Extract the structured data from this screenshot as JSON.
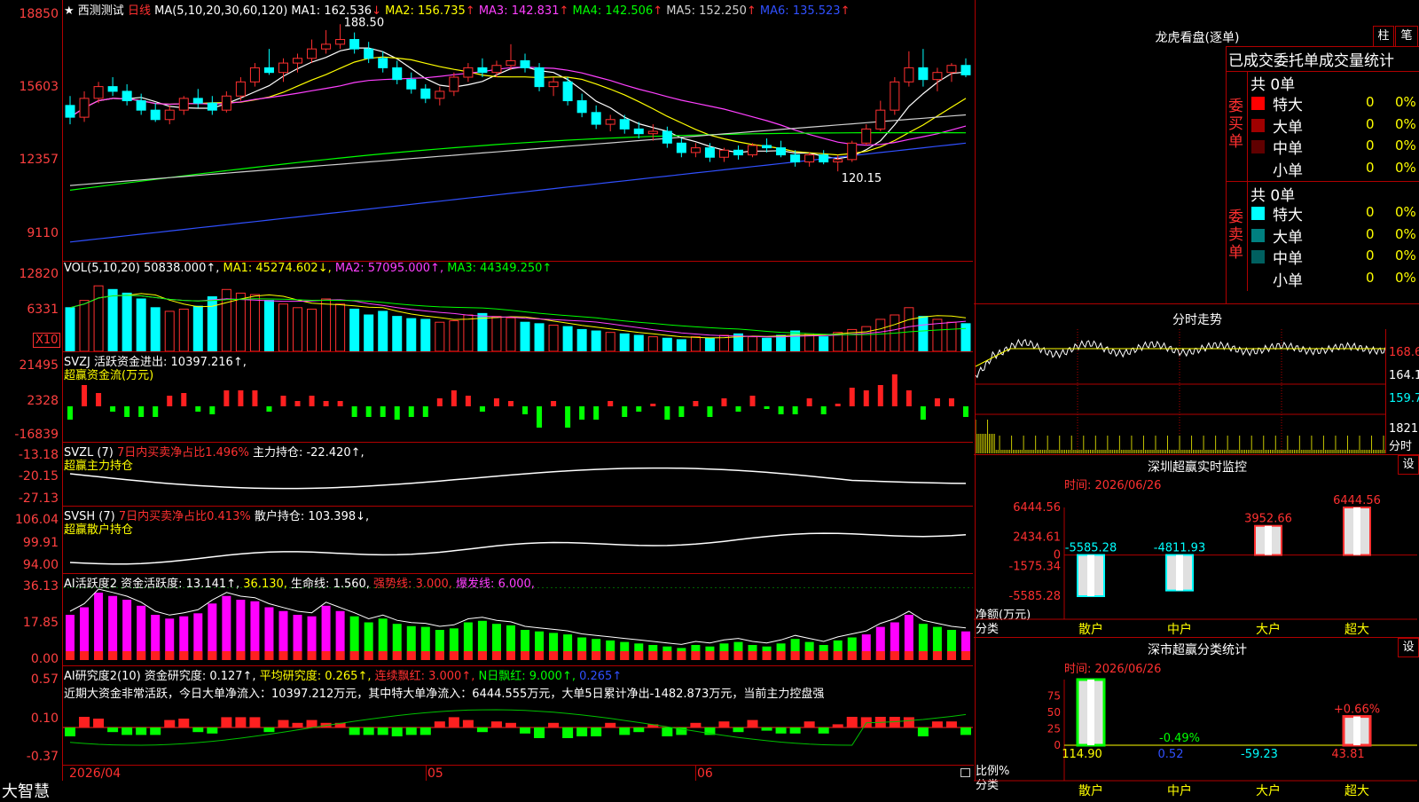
{
  "app_name": "大智慧",
  "main": {
    "stock_name": "西测测试",
    "period": "日线",
    "ma_prefix": "MA(5,10,20,30,60,120)",
    "ma": [
      {
        "label": "MA1: 162.536",
        "arrow": "↓",
        "color": "#ffffff"
      },
      {
        "label": "MA2: 156.735",
        "arrow": "↑",
        "color": "#ffff00"
      },
      {
        "label": "MA3: 142.831",
        "arrow": "↑",
        "color": "#ff40ff"
      },
      {
        "label": "MA4: 142.506",
        "arrow": "↑",
        "color": "#00ff00"
      },
      {
        "label": "MA5: 152.250",
        "arrow": "↑",
        "color": "#d0d0d0"
      },
      {
        "label": "MA6: 135.523",
        "arrow": "↑",
        "color": "#3050ff"
      }
    ],
    "y_ticks": [
      "18850",
      "15603",
      "12357",
      "9110"
    ],
    "high_label": "188.50",
    "low_label": "120.15"
  },
  "vol": {
    "header_parts": [
      {
        "t": "VOL(5,10,20)",
        "c": "#ffffff"
      },
      {
        "t": " 50838.000↑,",
        "c": "#ffffff"
      },
      {
        "t": " MA1: 45274.602↓,",
        "c": "#ffff00"
      },
      {
        "t": " MA2: 57095.000↑,",
        "c": "#ff40ff"
      },
      {
        "t": " MA3: 44349.250↑",
        "c": "#00ff00"
      }
    ],
    "y_ticks": [
      "12820",
      "6331"
    ],
    "unit": "X10"
  },
  "svzj": {
    "line1": "SVZJ  活跃资金进出: 10397.216↑,",
    "line2": "超赢资金流(万元)",
    "y_ticks": [
      "21495",
      "2328",
      "-16839"
    ]
  },
  "svzl": {
    "h_a": "SVZL (7)",
    "h_b": " 7日内买卖净占比1.496%",
    "h_c": " 主力持仓: -22.420↑,",
    "line2": "超赢主力持仓",
    "y_ticks": [
      "-13.18",
      "-20.15",
      "-27.13"
    ]
  },
  "svsh": {
    "h_a": "SVSH (7)",
    "h_b": " 7日内买卖净占比0.413%",
    "h_c": " 散户持仓: 103.398↓,",
    "line2": "超赢散户持仓",
    "y_ticks": [
      "106.04",
      "99.91",
      "94.00"
    ]
  },
  "ai_act": {
    "parts": [
      {
        "t": "AI活跃度2 资金活跃度: 13.141↑,",
        "c": "#ffffff"
      },
      {
        "t": " 36.130,",
        "c": "#ffff00"
      },
      {
        "t": " 生命线: 1.560,",
        "c": "#ffffff"
      },
      {
        "t": " 强势线: 3.000,",
        "c": "#ff3030"
      },
      {
        "t": " 爆发线: 6.000,",
        "c": "#ff40ff"
      }
    ],
    "y_ticks": [
      "36.13",
      "17.85",
      "0.00"
    ]
  },
  "ai_res": {
    "parts": [
      {
        "t": "AI研究度2(10) 资金研究度: 0.127↑,",
        "c": "#ffffff"
      },
      {
        "t": " 平均研究度: 0.265↑,",
        "c": "#ffff00"
      },
      {
        "t": " 连续飘红: 3.000↑,",
        "c": "#ff3030"
      },
      {
        "t": " N日飘红: 9.000↑,",
        "c": "#00ff00"
      },
      {
        "t": " 0.265↑",
        "c": "#3050ff"
      }
    ],
    "note": "近期大资金非常活跃，今日大单净流入：10397.212万元，其中特大单净流入：6444.555万元，大单5日累计净出-1482.873万元，当前主力控盘强",
    "y_ticks": [
      "0.57",
      "0.10",
      "-0.37"
    ]
  },
  "x_axis": [
    "2026/04",
    "05",
    "06"
  ],
  "right": {
    "dragon_title": "龙虎看盘(逐单)",
    "btn_bar": "柱",
    "btn_pen": "笔",
    "order_header": "已成交委托单成交量统计",
    "buy_group": "委买单",
    "sell_group": "委卖单",
    "buy_total": "共 0单",
    "sell_total": "共 0单",
    "buy_rows": [
      {
        "label": "特大",
        "count": "0",
        "pct": "0%",
        "color": "#ff0000"
      },
      {
        "label": "大单",
        "count": "0",
        "pct": "0%",
        "color": "#a00000"
      },
      {
        "label": "中单",
        "count": "0",
        "pct": "0%",
        "color": "#600000"
      },
      {
        "label": "小单",
        "count": "0",
        "pct": "0%",
        "color": ""
      }
    ],
    "sell_rows": [
      {
        "label": "特大",
        "count": "0",
        "pct": "0%",
        "color": "#00ffff"
      },
      {
        "label": "大单",
        "count": "0",
        "pct": "0%",
        "color": "#008080"
      },
      {
        "label": "中单",
        "count": "0",
        "pct": "0%",
        "color": "#006060"
      },
      {
        "label": "小单",
        "count": "0",
        "pct": "0%",
        "color": ""
      }
    ],
    "intraday_title": "分时走势",
    "intraday_prices": [
      "168.6",
      "164.1",
      "159.7"
    ],
    "intraday_vol": "1821",
    "intraday_vol_label": "分时",
    "sz_monitor_title": "深圳超赢实时监控",
    "sz_monitor_btn": "设",
    "sz_monitor_date": "时间: 2026/06/26",
    "sz_monitor_yticks": [
      "6444.56",
      "2434.61",
      "0",
      "-1575.34",
      "-5585.28"
    ],
    "sz_monitor_axis_label1": "净额(万元)",
    "sz_monitor_axis_label2": "分类",
    "sz_class_title": "深市超赢分类统计",
    "sz_class_btn": "设",
    "sz_class_date": "时间: 2026/06/26",
    "sz_class_yticks": [
      "75",
      "50",
      "25",
      "0"
    ],
    "sz_class_axis_label1": "比例%",
    "sz_class_axis_label2": "分类"
  },
  "chart_data": [
    {
      "type": "bar",
      "title": "深圳超赢实时监控",
      "categories": [
        "散户",
        "中户",
        "大户",
        "超大"
      ],
      "values": [
        -5585.28,
        -4811.93,
        3952.66,
        6444.56
      ],
      "value_labels": [
        "-5585.28",
        "-4811.93",
        "3952.66",
        "6444.56"
      ],
      "ylim": [
        -5585.28,
        6444.56
      ],
      "ylabel": "净额(万元)",
      "xlabel": "分类"
    },
    {
      "type": "bar",
      "title": "深市超赢分类统计",
      "categories": [
        "散户",
        "中户",
        "大户",
        "超大"
      ],
      "values": [
        114.9,
        0.52,
        -59.23,
        43.81
      ],
      "extra_labels": [
        "",
        "-0.49%",
        "",
        "+0.66%"
      ],
      "value_labels": [
        "114.90",
        "0.52",
        "-59.23",
        "43.81"
      ],
      "ylim": [
        0,
        100
      ],
      "ylabel": "比例%",
      "xlabel": "分类"
    },
    {
      "type": "line",
      "title": "K线",
      "candles": [
        [
          154,
          158,
          146,
          149
        ],
        [
          149,
          160,
          147,
          157
        ],
        [
          157,
          164,
          155,
          162
        ],
        [
          162,
          166,
          158,
          160
        ],
        [
          160,
          163,
          154,
          156
        ],
        [
          156,
          159,
          150,
          152
        ],
        [
          152,
          155,
          147,
          148
        ],
        [
          148,
          154,
          146,
          152
        ],
        [
          152,
          158,
          150,
          157
        ],
        [
          157,
          161,
          153,
          155
        ],
        [
          155,
          158,
          150,
          152
        ],
        [
          152,
          160,
          151,
          158
        ],
        [
          158,
          166,
          156,
          164
        ],
        [
          164,
          172,
          162,
          170
        ],
        [
          170,
          178,
          167,
          168
        ],
        [
          168,
          174,
          164,
          172
        ],
        [
          172,
          176,
          168,
          174
        ],
        [
          174,
          182,
          172,
          178
        ],
        [
          178,
          186,
          176,
          180
        ],
        [
          180,
          188.5,
          178,
          182
        ],
        [
          182,
          185,
          176,
          178
        ],
        [
          178,
          181,
          172,
          174
        ],
        [
          174,
          177,
          168,
          170
        ],
        [
          170,
          173,
          163,
          165
        ],
        [
          165,
          168,
          159,
          161
        ],
        [
          161,
          163,
          155,
          157
        ],
        [
          157,
          162,
          154,
          160
        ],
        [
          160,
          168,
          158,
          166
        ],
        [
          166,
          172,
          164,
          170
        ],
        [
          170,
          174,
          166,
          168
        ],
        [
          168,
          173,
          166,
          171
        ],
        [
          171,
          180,
          169,
          173
        ],
        [
          173,
          176,
          168,
          170
        ],
        [
          170,
          172,
          160,
          162
        ],
        [
          162,
          166,
          158,
          164
        ],
        [
          164,
          166,
          154,
          156
        ],
        [
          156,
          159,
          149,
          151
        ],
        [
          151,
          154,
          144,
          146
        ],
        [
          146,
          150,
          143,
          148
        ],
        [
          148,
          150,
          142,
          144
        ],
        [
          144,
          147,
          140,
          142
        ],
        [
          142,
          146,
          139,
          143
        ],
        [
          143,
          145,
          136,
          138
        ],
        [
          138,
          140,
          132,
          134
        ],
        [
          134,
          138,
          132,
          136
        ],
        [
          136,
          138,
          130,
          132
        ],
        [
          132,
          136,
          130,
          135
        ],
        [
          135,
          137,
          131,
          133
        ],
        [
          133,
          138,
          132,
          137
        ],
        [
          137,
          140,
          134,
          136
        ],
        [
          136,
          139,
          132,
          133
        ],
        [
          133,
          135,
          128,
          130
        ],
        [
          130,
          134,
          128,
          133
        ],
        [
          133,
          135,
          129,
          130
        ],
        [
          130,
          133,
          126,
          131
        ],
        [
          131,
          139,
          130,
          138
        ],
        [
          138,
          146,
          137,
          144
        ],
        [
          144,
          156,
          143,
          152
        ],
        [
          152,
          166,
          150,
          164
        ],
        [
          164,
          177,
          162,
          170
        ],
        [
          170,
          178,
          162,
          165
        ],
        [
          165,
          170,
          160,
          168
        ],
        [
          168,
          172,
          164,
          171
        ],
        [
          171,
          174,
          166,
          167
        ]
      ],
      "volumes": [
        60,
        70,
        90,
        85,
        80,
        72,
        60,
        55,
        58,
        62,
        75,
        85,
        80,
        78,
        70,
        65,
        60,
        58,
        72,
        65,
        58,
        50,
        55,
        48,
        45,
        44,
        40,
        42,
        50,
        52,
        48,
        46,
        40,
        38,
        36,
        34,
        30,
        28,
        26,
        24,
        22,
        20,
        18,
        16,
        20,
        18,
        22,
        24,
        20,
        18,
        22,
        28,
        24,
        20,
        26,
        30,
        34,
        44,
        50,
        60,
        48,
        44,
        40,
        38
      ],
      "y_ticks": [
        "18850",
        "15603",
        "12357",
        "9110"
      ]
    }
  ]
}
